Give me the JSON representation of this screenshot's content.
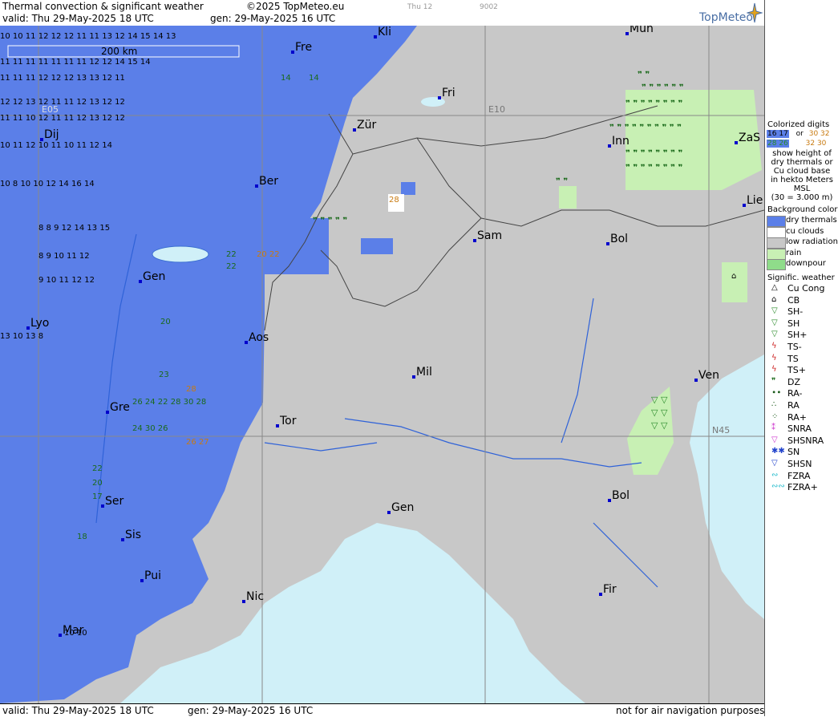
{
  "header": {
    "title": "Thermal convection & significant weather",
    "copyright": "©2025 TopMeteo.eu",
    "small_day": "Thu 12",
    "small_code": "9002",
    "valid": "valid:  Thu  29-May-2025  18 UTC",
    "gen": "gen: 29-May-2025 16 UTC",
    "logo": "TopMeteo"
  },
  "footer": {
    "valid": "valid:  Thu  29-May-2025  18 UTC",
    "gen": "gen: 29-May-2025 16 UTC",
    "note": "not for air navigation purposes"
  },
  "map": {
    "scale_label": "200 km",
    "grid_labels": [
      "E05",
      "E10",
      "N45"
    ],
    "colors": {
      "dry_thermals": "#5b7fe8",
      "cu_clouds": "#ffffff",
      "low_radiation": "#c8c8c8",
      "rain": "#c8f0b4",
      "downpour": "#8fdc8a",
      "sea": "#d0f0f8",
      "lake": "#d0f0f8"
    },
    "cities": [
      {
        "name": "Kli"
      },
      {
        "name": "Mün"
      },
      {
        "name": "Fre"
      },
      {
        "name": "Fri"
      },
      {
        "name": "Dij"
      },
      {
        "name": "Zür"
      },
      {
        "name": "Inn"
      },
      {
        "name": "ZaS"
      },
      {
        "name": "Ber"
      },
      {
        "name": "Lie"
      },
      {
        "name": "Sam"
      },
      {
        "name": "Bol"
      },
      {
        "name": "Gen"
      },
      {
        "name": "Lyo"
      },
      {
        "name": "Aos"
      },
      {
        "name": "Mil"
      },
      {
        "name": "Ven"
      },
      {
        "name": "Gre"
      },
      {
        "name": "Tor"
      },
      {
        "name": "Gen"
      },
      {
        "name": "Ser"
      },
      {
        "name": "Bol"
      },
      {
        "name": "Sis"
      },
      {
        "name": "Pui"
      },
      {
        "name": "Fir"
      },
      {
        "name": "Nic"
      },
      {
        "name": "Mar"
      }
    ]
  },
  "legend": {
    "colorized_title": "Colorized digits",
    "colorized_or": "or",
    "sample_a": "16 17",
    "sample_b": "28 26",
    "sample_c": "30 32",
    "sample_d": "32 30",
    "desc": [
      "show height of",
      "dry thermals or",
      "Cu cloud base",
      "in hekto Meters",
      "MSL",
      "(30 = 3.000 m)"
    ],
    "bg_title": "Background color",
    "bg_items": [
      {
        "label": "dry thermals",
        "color": "#5b7fe8"
      },
      {
        "label": "cu clouds",
        "color": "#ffffff"
      },
      {
        "label": "low radiation",
        "color": "#c8c8c8"
      },
      {
        "label": "rain",
        "color": "#c8f0b4"
      },
      {
        "label": "downpour",
        "color": "#8fdc8a"
      }
    ],
    "sig_title": "Signific. weather",
    "sig_items": [
      {
        "label": "Cu Cong",
        "icon": "cu-cong-icon",
        "sym": "△",
        "color": "#000"
      },
      {
        "label": "CB",
        "icon": "cb-icon",
        "sym": "⌂",
        "color": "#000"
      },
      {
        "label": "SH-",
        "icon": "showers-light-icon",
        "sym": "▽",
        "color": "#2a8a2a"
      },
      {
        "label": "SH",
        "icon": "showers-icon",
        "sym": "▽",
        "color": "#2a8a2a"
      },
      {
        "label": "SH+",
        "icon": "showers-heavy-icon",
        "sym": "▽",
        "color": "#2a8a2a"
      },
      {
        "label": "TS-",
        "icon": "thunderstorm-light-icon",
        "sym": "ϟ",
        "color": "#cc2222"
      },
      {
        "label": "TS",
        "icon": "thunderstorm-icon",
        "sym": "ϟ",
        "color": "#cc2222"
      },
      {
        "label": "TS+",
        "icon": "thunderstorm-heavy-icon",
        "sym": "ϟ",
        "color": "#cc2222"
      },
      {
        "label": "DZ",
        "icon": "drizzle-icon",
        "sym": "❞",
        "color": "#1a6a1a"
      },
      {
        "label": "RA-",
        "icon": "rain-light-icon",
        "sym": "∙∙",
        "color": "#1a5a1a"
      },
      {
        "label": "RA",
        "icon": "rain-icon",
        "sym": "∴",
        "color": "#1a5a1a"
      },
      {
        "label": "RA+",
        "icon": "rain-heavy-icon",
        "sym": "⁘",
        "color": "#1a5a1a"
      },
      {
        "label": "SNRA",
        "icon": "sleet-icon",
        "sym": "⁑",
        "color": "#cc33cc"
      },
      {
        "label": "SHSNRA",
        "icon": "sleet-showers-icon",
        "sym": "▽",
        "color": "#cc33cc"
      },
      {
        "label": "SN",
        "icon": "snow-icon",
        "sym": "✱✱",
        "color": "#2244cc"
      },
      {
        "label": "SHSN",
        "icon": "snow-showers-icon",
        "sym": "▽",
        "color": "#2244cc"
      },
      {
        "label": "FZRA",
        "icon": "freezing-rain-icon",
        "sym": "∾",
        "color": "#22bbcc"
      },
      {
        "label": "FZRA+",
        "icon": "freezing-rain-heavy-icon",
        "sym": "∾∾",
        "color": "#22bbcc"
      }
    ]
  }
}
